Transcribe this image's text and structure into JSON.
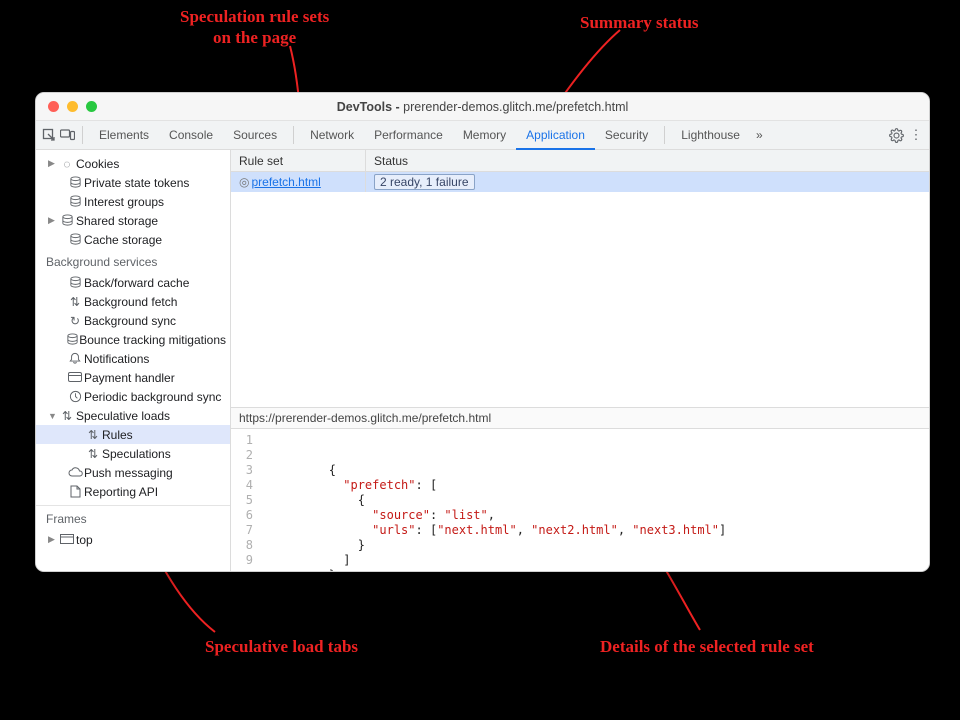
{
  "annotations": {
    "rule_sets": "Speculation rule sets\non the page",
    "summary": "Summary status",
    "spec_tabs": "Speculative load tabs",
    "details": "Details of the selected rule set"
  },
  "window": {
    "title_prefix": "DevTools - ",
    "title_page": "prerender-demos.glitch.me/prefetch.html"
  },
  "tabs": {
    "elements": "Elements",
    "console": "Console",
    "sources": "Sources",
    "network": "Network",
    "performance": "Performance",
    "memory": "Memory",
    "application": "Application",
    "security": "Security",
    "lighthouse": "Lighthouse"
  },
  "sidebar": {
    "app": {
      "cookies": "Cookies",
      "pst": "Private state tokens",
      "interest": "Interest groups",
      "shared": "Shared storage",
      "cache": "Cache storage"
    },
    "bg": {
      "title": "Background services",
      "bfcache": "Back/forward cache",
      "bgfetch": "Background fetch",
      "bgsync": "Background sync",
      "bounce": "Bounce tracking mitigations",
      "notif": "Notifications",
      "pay": "Payment handler",
      "periodic": "Periodic background sync",
      "specloads": "Speculative loads",
      "rules": "Rules",
      "speculations": "Speculations",
      "push": "Push messaging",
      "reporting": "Reporting API"
    },
    "frames": {
      "title": "Frames",
      "top": "top"
    }
  },
  "ruletable": {
    "col_ruleset": "Rule set",
    "col_status": "Status",
    "row0_ruleset": "prefetch.html",
    "row0_status": "2 ready, 1 failure"
  },
  "details": {
    "url": "https://prerender-demos.glitch.me/prefetch.html",
    "code": {
      "l1": " ",
      "l2": "{",
      "l3_k": "\"prefetch\"",
      "l3_s": ": [",
      "l4": "{",
      "l5_k": "\"source\"",
      "l5_v": "\"list\"",
      "l6_k": "\"urls\"",
      "l6_a": "\"next.html\"",
      "l6_b": "\"next2.html\"",
      "l6_c": "\"next3.html\"",
      "l7": "}",
      "l8": "]",
      "l9": "}"
    },
    "linenos": [
      "1",
      "2",
      "3",
      "4",
      "5",
      "6",
      "7",
      "8",
      "9"
    ]
  }
}
